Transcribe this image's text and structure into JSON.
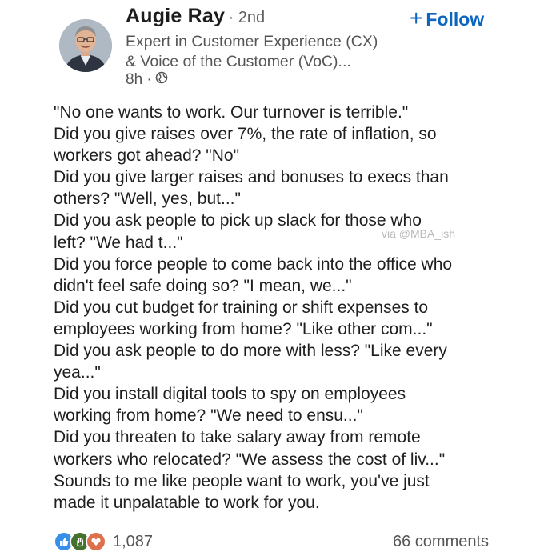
{
  "author": {
    "name": "Augie Ray",
    "degree": "· 2nd",
    "headline_line1": "Expert in Customer Experience (CX)",
    "headline_line2": "& Voice of the Customer (VoC)...",
    "time": "8h ·"
  },
  "follow": {
    "label": "Follow",
    "icon": "plus-icon",
    "color": "#0a66c2"
  },
  "post": {
    "lines": [
      "\"No one wants to work. Our turnover is terrible.\"",
      "Did you give raises over 7%, the rate of inflation, so",
      "workers got ahead? \"No\"",
      "Did you give larger raises and bonuses to execs than",
      "others? \"Well, yes, but...\"",
      "Did you ask people to pick up slack for those who",
      "left? \"We had t...\"",
      "Did you force people to come back into the office who",
      "didn't feel safe doing so? \"I mean, we...\"",
      "Did you cut budget for training or shift expenses to",
      "employees working from home? \"Like other com...\"",
      "Did you ask people to do more with less? \"Like every",
      "yea...\"",
      "Did you install digital tools to spy on employees",
      "working from home? \"We need to ensu...\"",
      "Did you threaten to take salary away from remote",
      "workers who relocated? \"We assess the cost of liv...\"",
      "Sounds to me like people want to work, you've just",
      "made it unpalatable to work for you."
    ],
    "watermark": "via @MBA_ish"
  },
  "social": {
    "reactions": [
      {
        "icon": "like-icon",
        "color": "#378fe9"
      },
      {
        "icon": "celebrate-icon",
        "color": "#44712e"
      },
      {
        "icon": "love-icon",
        "color": "#df704d"
      }
    ],
    "reaction_count": "1,087",
    "comments": "66 comments"
  }
}
